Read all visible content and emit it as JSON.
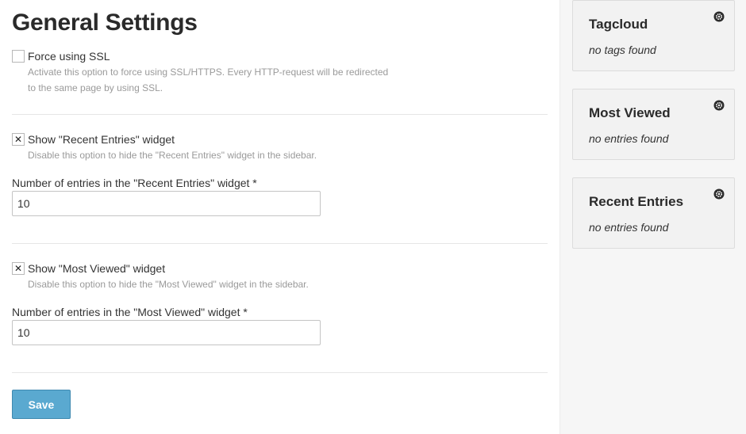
{
  "page": {
    "title": "General Settings"
  },
  "settings": {
    "ssl": {
      "label": "Force using SSL",
      "checked": false,
      "check_mark": "",
      "help_line1": "Activate this option to force using SSL/HTTPS. Every HTTP-request will be redirected",
      "help_line2": "to the same page by using SSL."
    },
    "recent": {
      "label": "Show \"Recent Entries\" widget",
      "checked": true,
      "check_mark": "✕",
      "help": "Disable this option to hide the \"Recent Entries\" widget in the sidebar.",
      "count_label": "Number of entries in the \"Recent Entries\" widget *",
      "count_value": "10"
    },
    "viewed": {
      "label": "Show \"Most Viewed\" widget",
      "checked": true,
      "check_mark": "✕",
      "help": "Disable this option to hide the \"Most Viewed\" widget in the sidebar.",
      "count_label": "Number of entries in the \"Most Viewed\" widget *",
      "count_value": "10"
    },
    "save_label": "Save"
  },
  "sidebar": {
    "widgets": [
      {
        "title": "Tagcloud",
        "empty_text": "no tags found",
        "icon": "gear-icon"
      },
      {
        "title": "Most Viewed",
        "empty_text": "no entries found",
        "icon": "gear-icon"
      },
      {
        "title": "Recent Entries",
        "empty_text": "no entries found",
        "icon": "gear-icon"
      }
    ]
  },
  "colors": {
    "save_button": "#5aa9d0",
    "sidebar_background": "#f6f6f6",
    "help_text": "#9a9a9a"
  }
}
